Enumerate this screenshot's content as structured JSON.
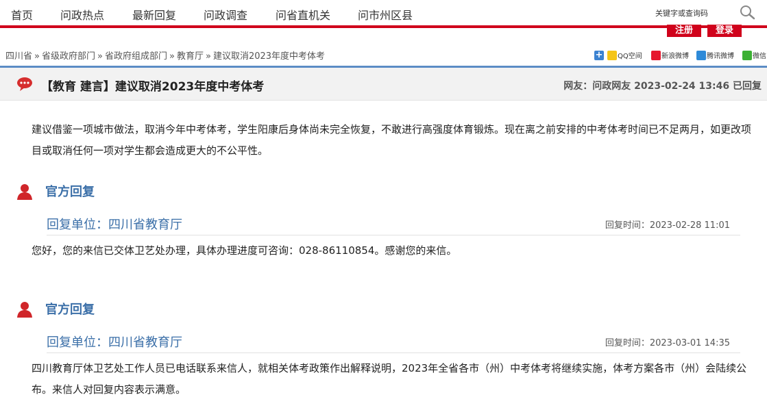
{
  "nav": {
    "items": [
      "首页",
      "问政热点",
      "最新回复",
      "问政调查",
      "问省直机关",
      "问市州区县"
    ],
    "search_placeholder": "关键字或查询码",
    "register": "注册",
    "login": "登录"
  },
  "breadcrumb": {
    "items": [
      "四川省",
      "省级政府部门",
      "省政府组成部门",
      "教育厅",
      "建议取消2023年度中考体考"
    ],
    "separator": "»"
  },
  "share": [
    "QQ空间",
    "新浪微博",
    "腾讯微博",
    "微信"
  ],
  "post": {
    "title": "【教育 建言】建议取消2023年度中考体考",
    "meta": "网友：问政网友  2023-02-24 13:46 已回复",
    "content": "建议借鉴一项城市做法，取消今年中考体考，学生阳康后身体尚未完全恢复，不敢进行高强度体育锻炼。现在离之前安排的中考体考时间已不足两月，如更改项目或取消任何一项对学生都会造成更大的不公平性。"
  },
  "replies": [
    {
      "heading": "官方回复",
      "unit": "回复单位：四川省教育厅",
      "time": "回复时间：2023-02-28 11:01",
      "text": "您好，您的来信已交体卫艺处办理，具体办理进度可咨询：028-86110854。感谢您的来信。"
    },
    {
      "heading": "官方回复",
      "unit": "回复单位：四川省教育厅",
      "time": "回复时间：2023-03-01 14:35",
      "text": "四川教育厅体卫艺处工作人员已电话联系来信人，就相关体考政策作出解释说明，2023年全省各市（州）中考体考将继续实施，体考方案各市（州）会陆续公布。来信人对回复内容表示满意。"
    }
  ],
  "colors": {
    "brand_red": "#d0021b",
    "link_blue": "#3b6fa8",
    "rule_blue": "#5b8cc5"
  }
}
